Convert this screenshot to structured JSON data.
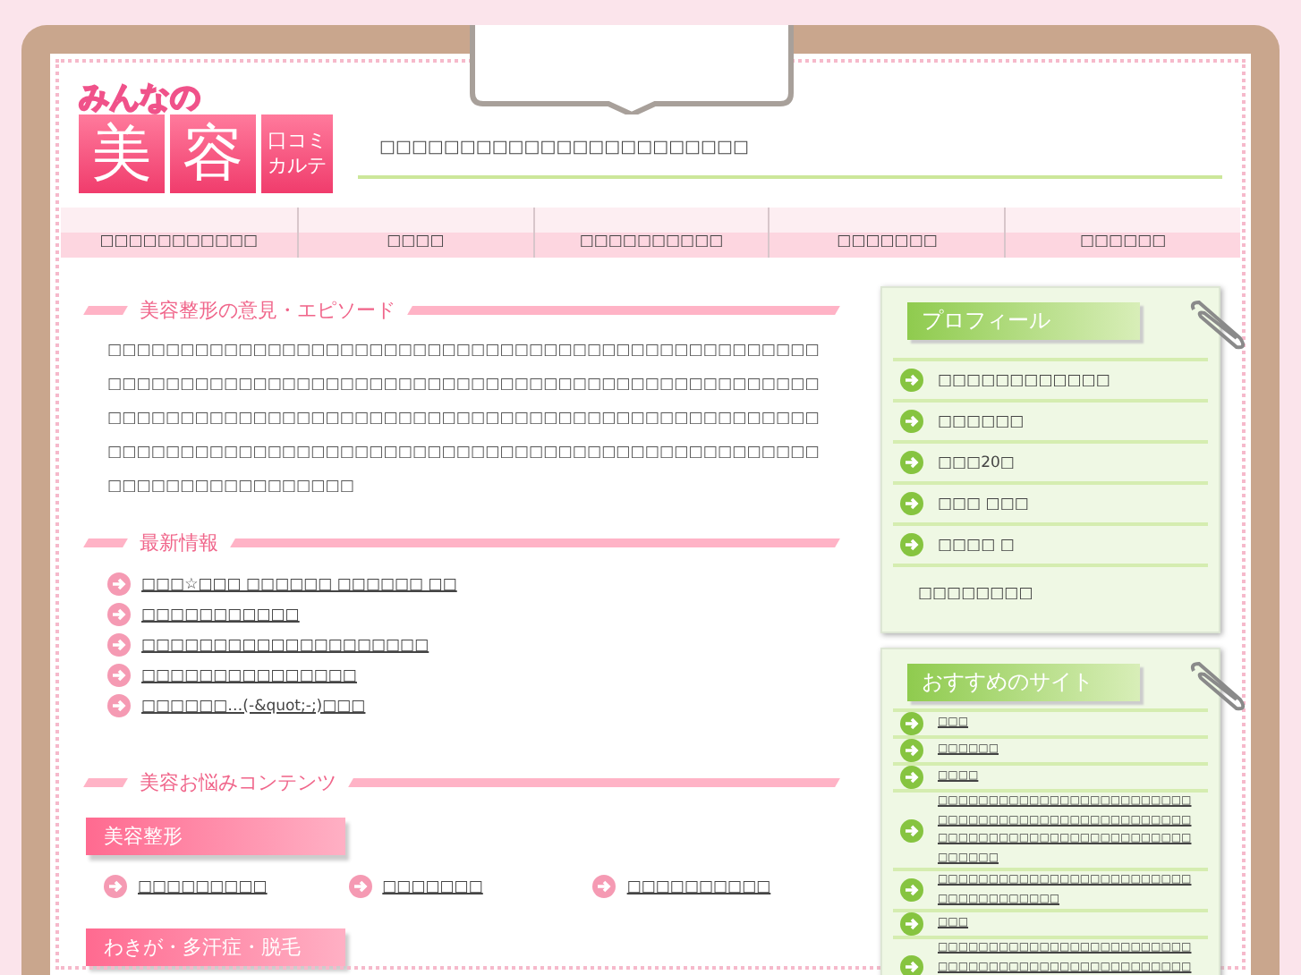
{
  "header": {
    "logo_small": "みんなの",
    "logo_main": [
      "美",
      "容"
    ],
    "logo_side": [
      "口コミ",
      "カルテ"
    ],
    "tagline": "□□□□□□□□□□□□□□□□□□□□□□□"
  },
  "nav": [
    "□□□□□□□□□□□",
    "□□□□",
    "□□□□□□□□□□",
    "□□□□□□□",
    "□□□□□□"
  ],
  "episode": {
    "title": "美容整形の意見・エピソード",
    "body": "□□□□□□□□□□□□□□□□□□□□□□□□□□□□□□□□□□□□□□□□□□□□□□□□□□□□□□□□□□□□□□□□□□□□□□□□□□□□□□□□□□□□□□□□□□□□□□□□□□□□□□□□□□□□□□□□□□□□□□□□□□□□□□□□□□□□□□□□□□□□□□□□□□□□□□□□□□□□□□□□□□□□□□□□□□□□□□□□□□□□□□□□□□□□□□□□□□□□□□□□□□□□□□□□□□□□□"
  },
  "news": {
    "title": "最新情報",
    "items": [
      "□□□☆□□□ □□□□□□ □□□□□□ □□",
      "□□□□□□□□□□□",
      "□□□□□□□□□□□□□□□□□□□□",
      "□□□□□□□□□□□□□□□",
      "□□□□□□…(-&quot;-;)□□□"
    ]
  },
  "contents": {
    "title": "美容お悩みコンテンツ",
    "categories": [
      {
        "title": "美容整形",
        "links": [
          "□□□□□□□□□",
          "□□□□□□□",
          "□□□□□□□□□□"
        ]
      },
      {
        "title": "わきが・多汗症・脱毛"
      }
    ]
  },
  "profile": {
    "title": "プロフィール",
    "items": [
      "□□□□□□□□□□□□",
      "□□□□□□",
      "□□□20□",
      "□□□ □□□",
      "□□□□ □"
    ],
    "note": "□□□□□□□□"
  },
  "recommended": {
    "title": "おすすめのサイト",
    "items": [
      "□□□",
      "□□□□□□",
      "□□□□",
      "□□□□□□□□□□□□□□□□□□□□□□□□□□□□□□□□□□□□□□□□□□□□□□□□□□□□□□□□□□□□□□□□□□□□□□□□□□□□□□□□□",
      "□□□□□□□□□□□□□□□□□□□□□□□□□□□□□□□□□□□□□",
      "□□□",
      "□□□□□□□□□□□□□□□□□□□□□□□□□□□□□□□□□□□□□□□□□□□□□□□□□□□□□□…"
    ]
  }
}
